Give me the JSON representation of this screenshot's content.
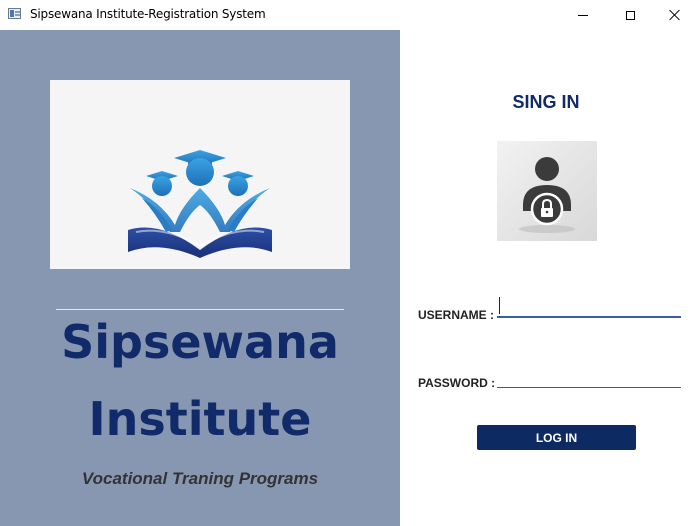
{
  "window": {
    "title": "Sipsewana Institute-Registration System"
  },
  "brand": {
    "line1": "Sipsewana",
    "line2": "Institute",
    "tagline": "Vocational Traning Programs"
  },
  "login": {
    "heading": "SING IN",
    "username_label": "USERNAME :",
    "password_label": "PASSWORD :",
    "username_value": "",
    "password_value": "",
    "button_label": "LOG IN"
  },
  "icons": {
    "app": "app-window-icon",
    "logo": "graduates-book-logo",
    "user": "user-lock-icon"
  },
  "colors": {
    "panel": "#8797b2",
    "brand_text": "#102a6a",
    "button": "#0e2a63",
    "accent_underline": "#3a5da8"
  }
}
